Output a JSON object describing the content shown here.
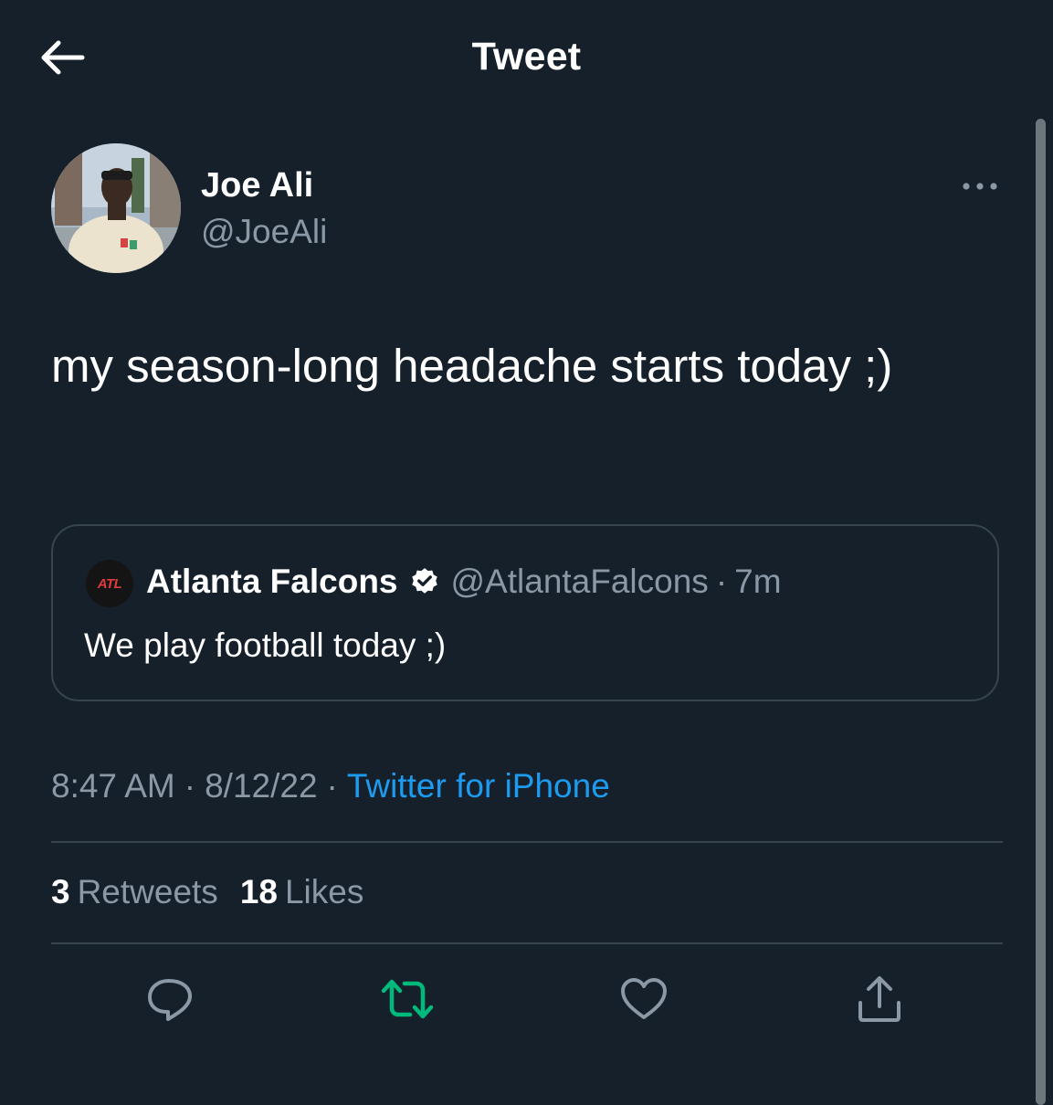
{
  "header": {
    "title": "Tweet",
    "back_icon": "arrow-left-icon"
  },
  "tweet": {
    "author_name": "Joe Ali",
    "author_handle": "@JoeAli",
    "text": "my season-long headache starts today ;)",
    "time": "8:47 AM",
    "date": "8/12/22",
    "source": "Twitter for iPhone"
  },
  "quoted_tweet": {
    "avatar_text": "ATL",
    "author_name": "Atlanta Falcons",
    "author_handle": "@AtlantaFalcons",
    "separator": "·",
    "age": "7m",
    "text": "We play football today ;)"
  },
  "stats": {
    "retweets_count": "3",
    "retweets_label": "Retweets",
    "likes_count": "18",
    "likes_label": "Likes"
  },
  "meta_separator": "·",
  "actions": [
    "reply-icon",
    "retweet-icon",
    "like-icon",
    "share-icon"
  ],
  "colors": {
    "background": "#15202b",
    "text_primary": "#ffffff",
    "text_secondary": "#8b98a5",
    "link": "#1d9bf0",
    "border": "#38444d",
    "retweet_active": "#00ba7c"
  }
}
